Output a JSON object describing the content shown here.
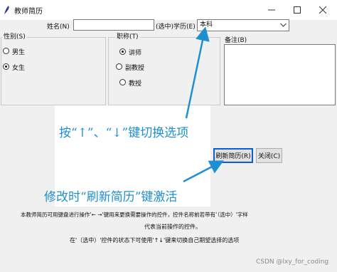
{
  "window": {
    "title": "教师简历",
    "colors": {
      "accent": "#1e8fd0",
      "focus": "#0a5fd6"
    }
  },
  "form": {
    "name_label": "姓名(N)",
    "name_value": "",
    "degree_label": "(选中)学历(E)",
    "degree_value": "本科",
    "gender": {
      "title": "性别(S)",
      "options": [
        {
          "label": "男生",
          "selected": false
        },
        {
          "label": "女生",
          "selected": true
        }
      ]
    },
    "rank": {
      "title": "职称(T)",
      "options": [
        {
          "label": "讲师",
          "selected": true
        },
        {
          "label": "副教授",
          "selected": false
        },
        {
          "label": "教授",
          "selected": false
        }
      ]
    },
    "notes": {
      "title": "备注(B)",
      "value": ""
    }
  },
  "buttons": {
    "refresh": "刷新简历(R)",
    "close": "关闭(C)"
  },
  "annotations": {
    "arrow_keys": "按“↑”、“↓”键切换选项",
    "refresh_hint": "修改时“刷新简历”键激活"
  },
  "footnote": {
    "line1": "本教师简历可用键盘进行操作'← →'键用来更换需要操作的控件，控件名称前若带有‘（选中）'字样",
    "line2": "代表当前操作的控件。",
    "line3": "在'（选中）'控件的状态下可使用'↑↓'键来切换自己期望选择的选项"
  },
  "watermark": "CSDN @lxy_for_coding",
  "icons": [
    "feather-icon",
    "minimize-icon",
    "maximize-icon",
    "close-icon",
    "chevron-down-icon",
    "arrow-icon"
  ]
}
